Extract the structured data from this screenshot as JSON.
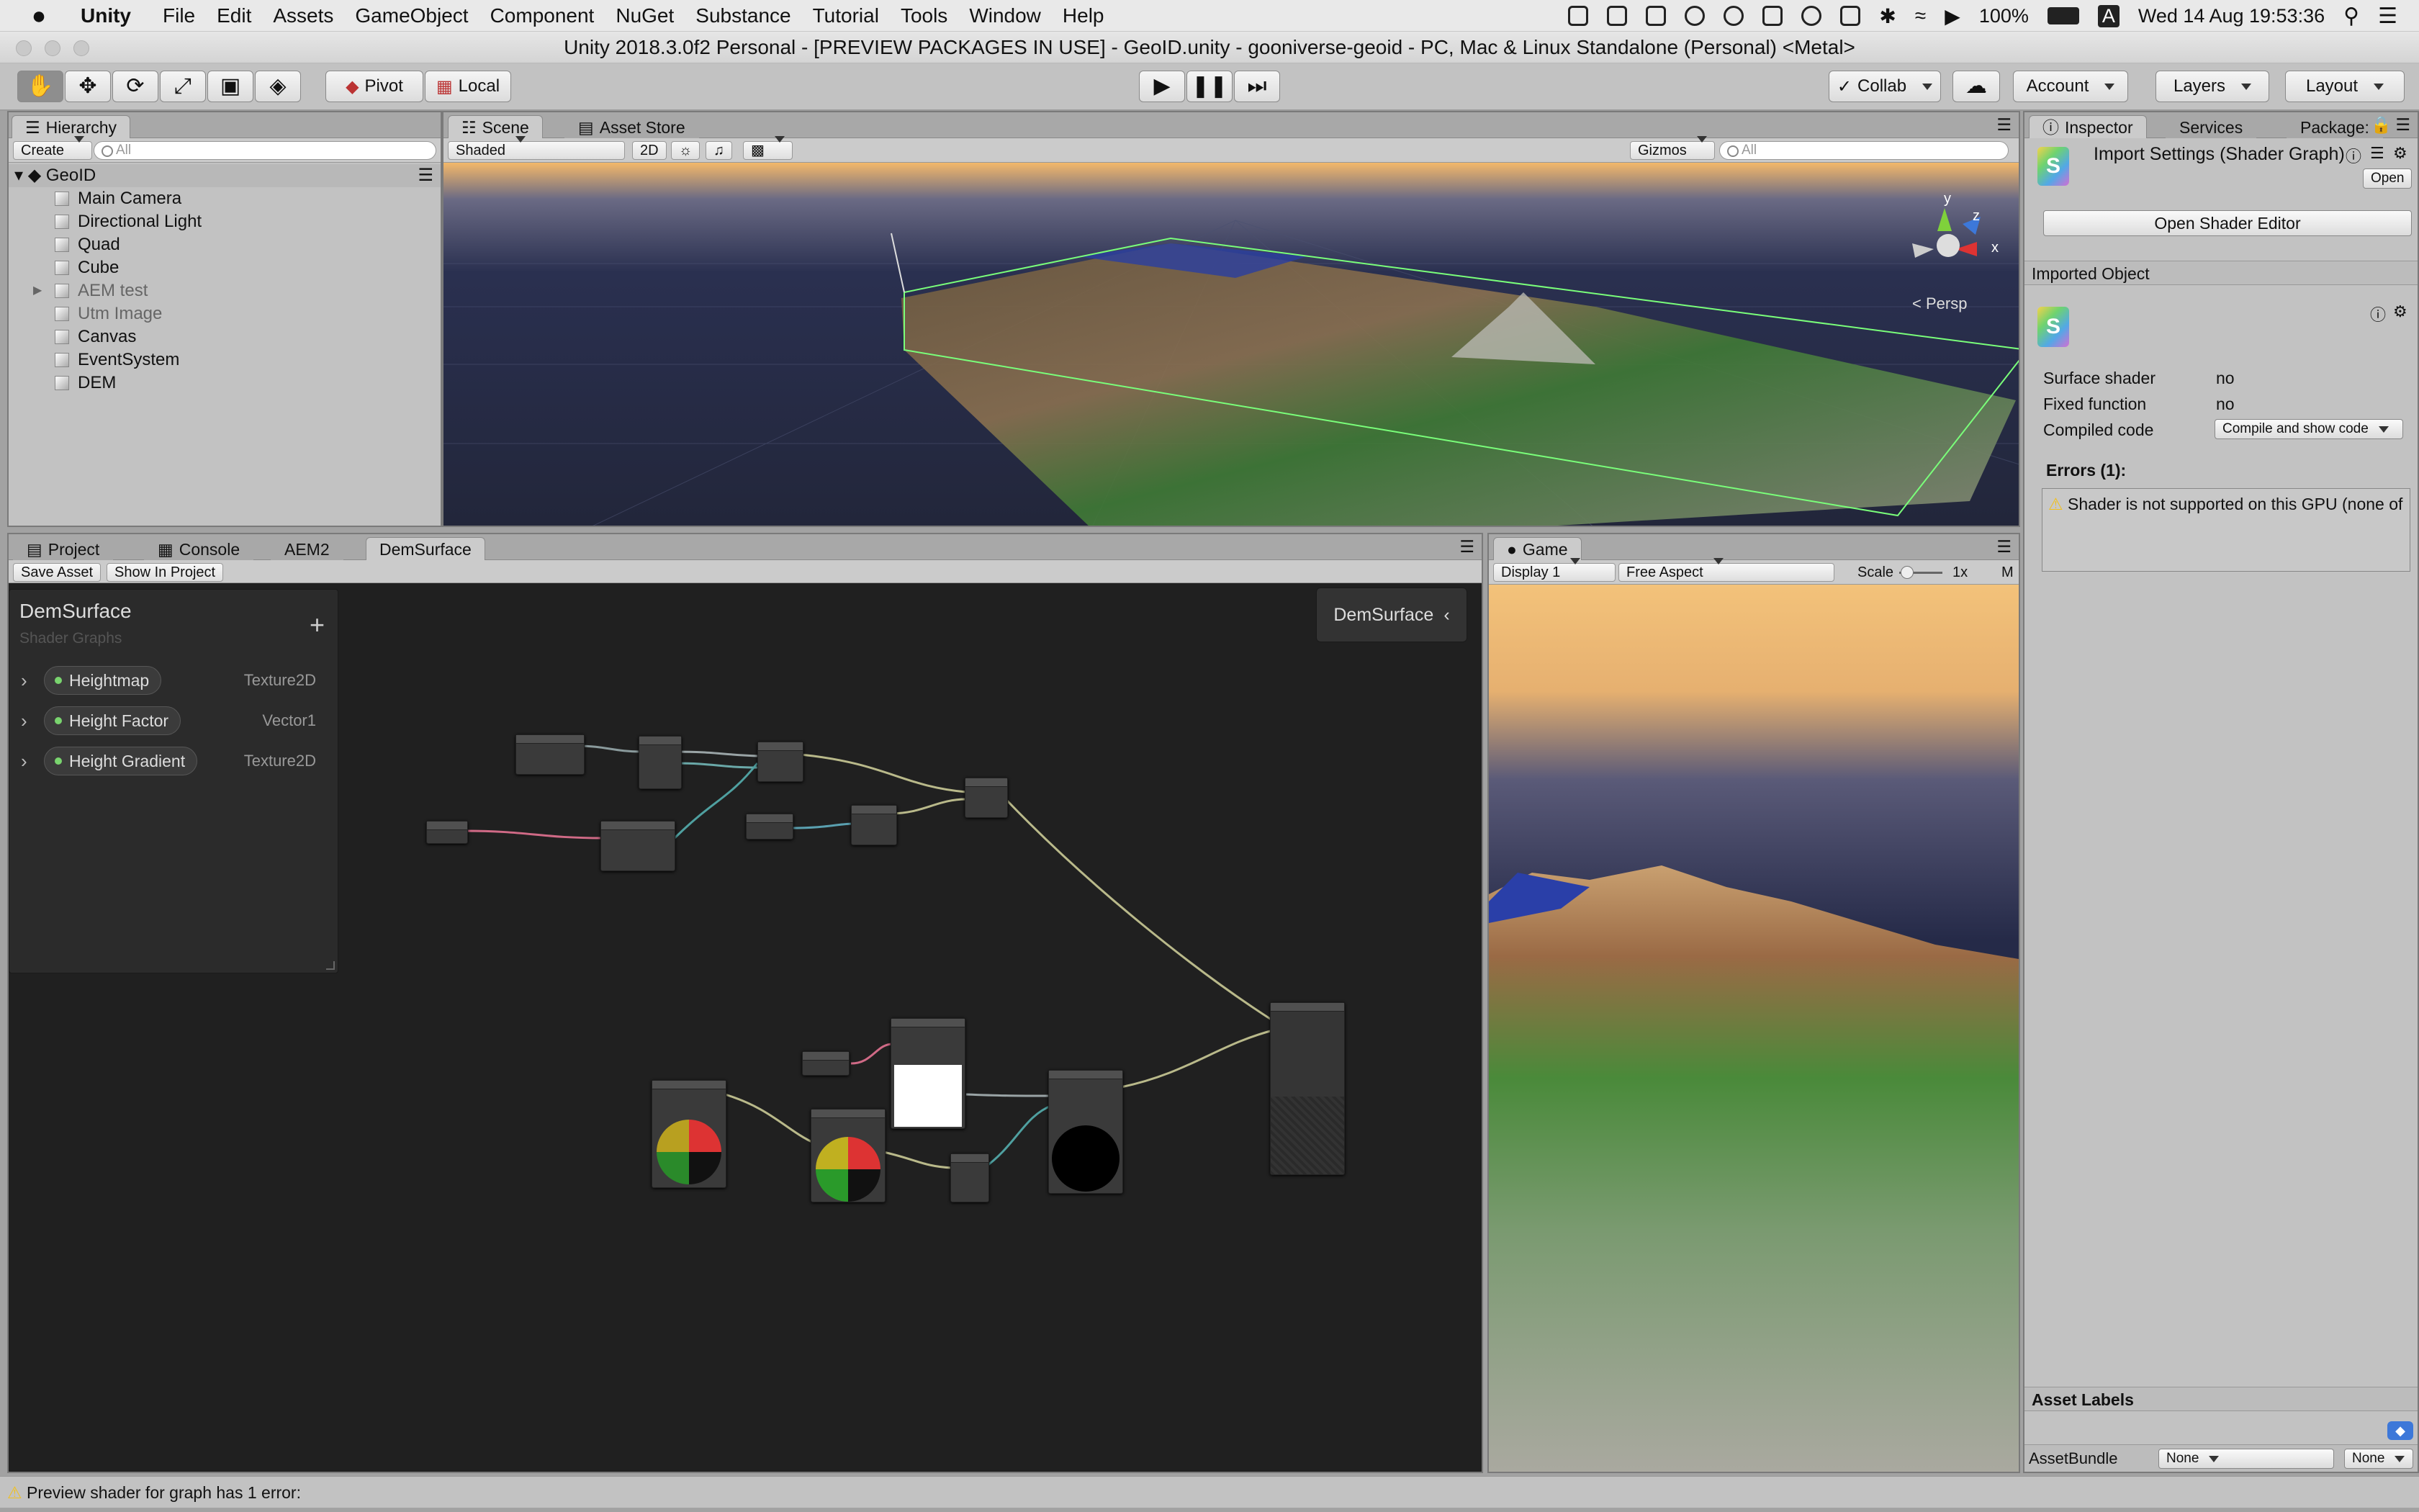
{
  "menubar": {
    "apple": "",
    "app_name": "Unity",
    "items": [
      "File",
      "Edit",
      "Assets",
      "GameObject",
      "Component",
      "NuGet",
      "Substance",
      "Tutorial",
      "Tools",
      "Window",
      "Help"
    ],
    "battery": "100%",
    "datetime": "Wed 14 Aug  19:53:36",
    "input_letter": "A"
  },
  "window": {
    "title": "Unity 2018.3.0f2 Personal - [PREVIEW PACKAGES IN USE] - GeoID.unity - gooniverse-geoid - PC, Mac & Linux Standalone (Personal) <Metal>"
  },
  "toolbar": {
    "pivot": "Pivot",
    "local": "Local",
    "collab": "Collab",
    "account": "Account",
    "layers": "Layers",
    "layout": "Layout"
  },
  "hierarchy": {
    "tab": "Hierarchy",
    "create": "Create",
    "search_placeholder": "All",
    "scene": "GeoID",
    "items": [
      {
        "label": "Main Camera",
        "dim": false
      },
      {
        "label": "Directional Light",
        "dim": false
      },
      {
        "label": "Quad",
        "dim": false
      },
      {
        "label": "Cube",
        "dim": false
      },
      {
        "label": "AEM test",
        "dim": true
      },
      {
        "label": "Utm Image",
        "dim": true
      },
      {
        "label": "Canvas",
        "dim": false
      },
      {
        "label": "EventSystem",
        "dim": false
      },
      {
        "label": "DEM",
        "dim": false
      }
    ]
  },
  "scene": {
    "tabs": [
      "Scene",
      "Asset Store"
    ],
    "shading": "Shaded",
    "mode2d": "2D",
    "gizmos": "Gizmos",
    "search_placeholder": "All",
    "persp": "< Persp",
    "axis_y": "y",
    "axis_z": "z",
    "axis_x": "x"
  },
  "bottom": {
    "tabs": [
      "Project",
      "Console",
      "AEM2",
      "DemSurface"
    ],
    "save_asset": "Save Asset",
    "show_in_project": "Show In Project",
    "status": "Preview shader for graph has 1 error:"
  },
  "blackboard": {
    "title": "DemSurface",
    "subtitle": "Shader Graphs",
    "add": "+",
    "properties": [
      {
        "name": "Heightmap",
        "type": "Texture2D"
      },
      {
        "name": "Height Factor",
        "type": "Vector1"
      },
      {
        "name": "Height Gradient",
        "type": "Texture2D"
      }
    ],
    "master_preview": "DemSurface"
  },
  "game": {
    "tab": "Game",
    "display": "Display 1",
    "aspect": "Free Aspect",
    "scale_label": "Scale",
    "scale_value": "1x",
    "trunc": "M"
  },
  "inspector": {
    "tabs": [
      "Inspector",
      "Services",
      "Package:"
    ],
    "header": "Import Settings (Shader Graph)",
    "open": "Open",
    "open_shader_editor": "Open Shader Editor",
    "imported_object": "Imported Object",
    "fields": [
      {
        "label": "Surface shader",
        "value": "no"
      },
      {
        "label": "Fixed function",
        "value": "no"
      }
    ],
    "compiled_code_label": "Compiled code",
    "compiled_code_value": "Compile and show code",
    "errors_label": "Errors (1):",
    "error_text": "Shader is not supported on this GPU (none of",
    "asset_labels": "Asset Labels",
    "asset_bundle_label": "AssetBundle",
    "asset_bundle_value": "None",
    "asset_bundle_variant": "None"
  },
  "colors": {
    "accent": "#3d78d9",
    "graph_bg": "#202020",
    "error_icon": "#f0c020",
    "terrain_green": "#4a8a3a",
    "terrain_brown": "#9a7a55",
    "sky_orange": "#f0b050"
  }
}
